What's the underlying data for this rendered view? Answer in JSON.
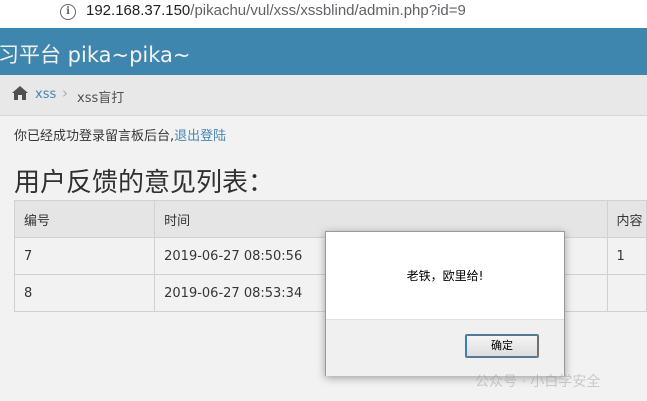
{
  "browser": {
    "url_host": "192.168.37.150",
    "url_path": "/pikachu/vul/xss/xssblind/admin.php?id=9"
  },
  "header": {
    "brand": "习平台 pika~pika~"
  },
  "breadcrumb": {
    "link": "xss",
    "current": "xss盲打"
  },
  "login": {
    "text": "你已经成功登录留言板后台,",
    "logout_link": "退出登陆"
  },
  "page_title": "用户反馈的意见列表：",
  "table": {
    "headers": [
      "编号",
      "时间",
      "内容"
    ],
    "rows": [
      [
        "7",
        "2019-06-27 08:50:56",
        "1"
      ],
      [
        "8",
        "2019-06-27 08:53:34",
        ""
      ]
    ]
  },
  "dialog": {
    "message": "老铁，欧里给!",
    "ok_label": "确定"
  },
  "watermark": "公众号 · 小白学安全"
}
